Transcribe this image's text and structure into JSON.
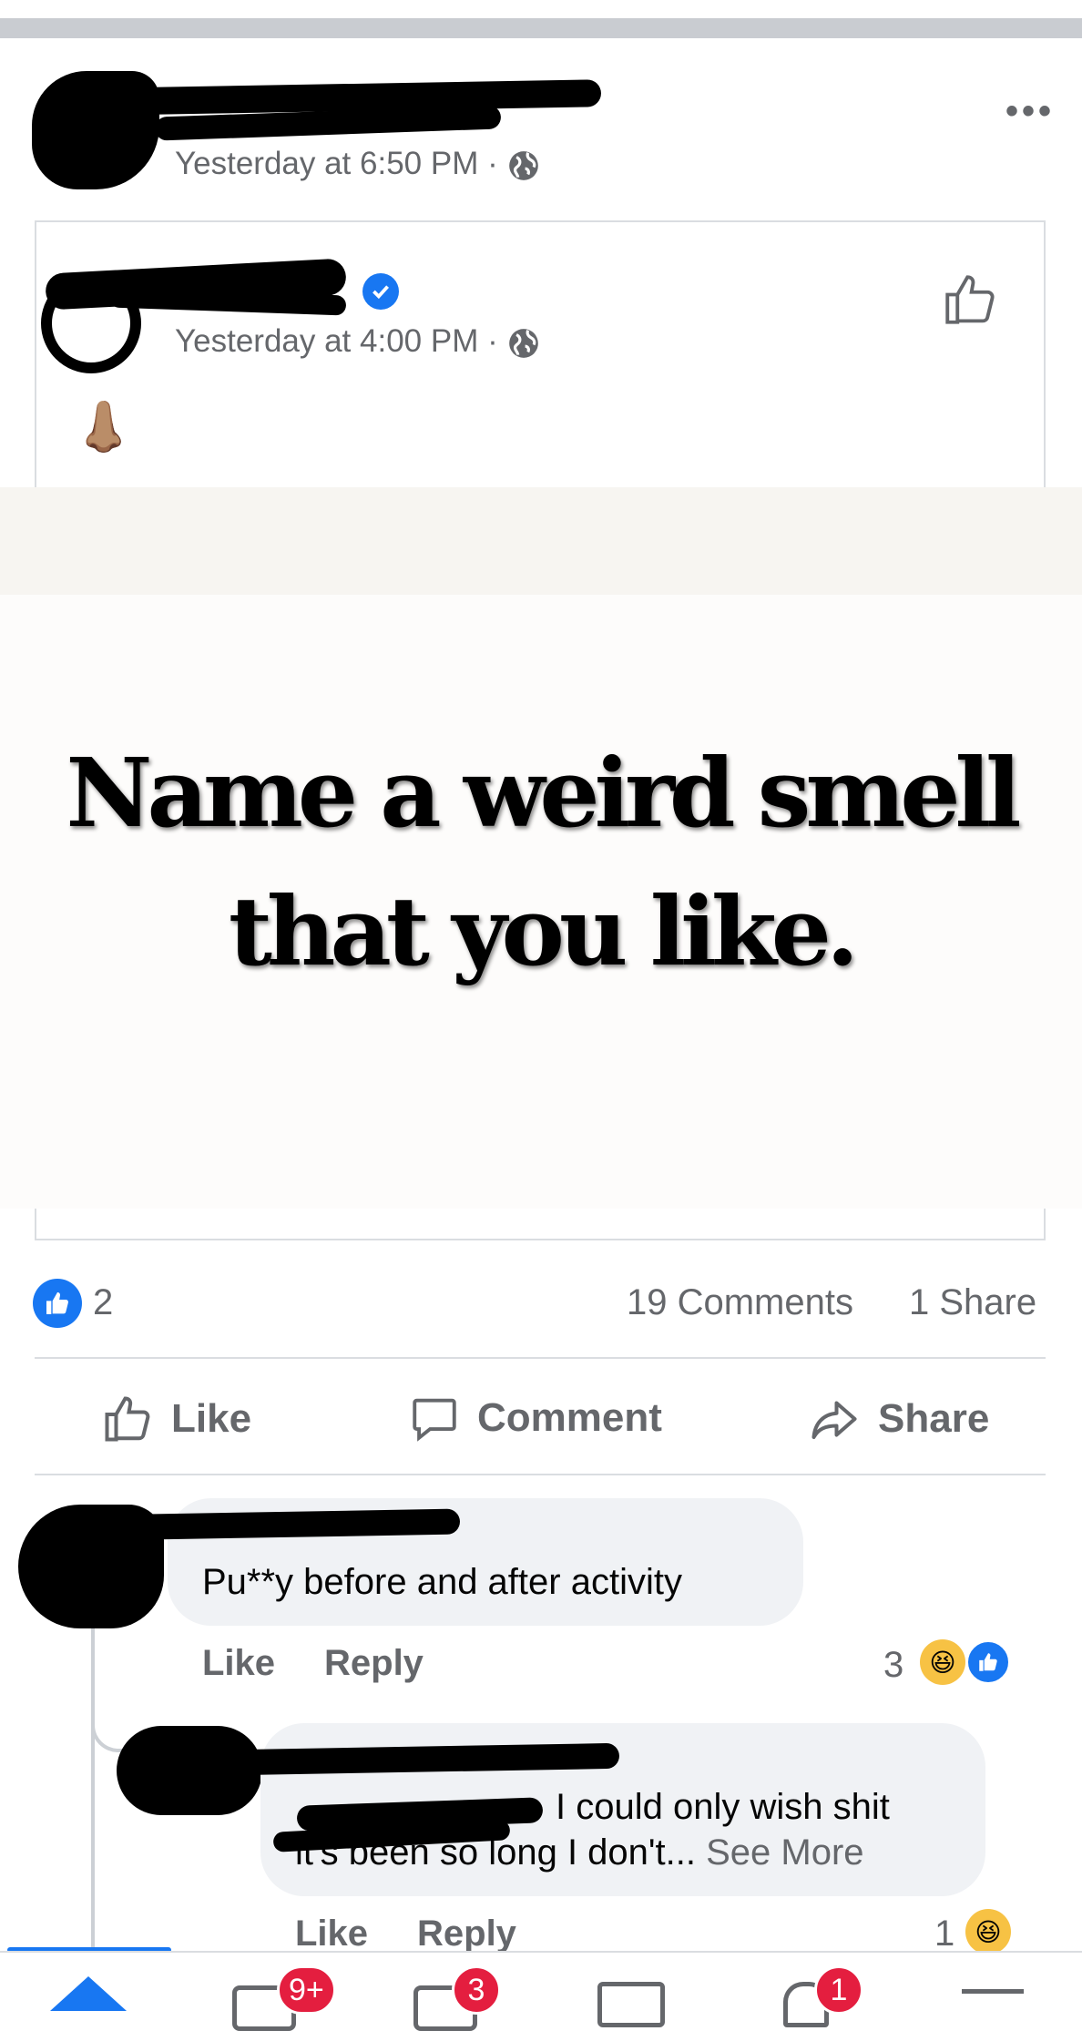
{
  "post": {
    "timestamp": "Yesterday at 6:50 PM",
    "separator": "·"
  },
  "shared_post": {
    "timestamp": "Yesterday at 4:00 PM",
    "separator": "·",
    "emoji": "👃🏽",
    "image_text": "Name a weird smell that you like."
  },
  "stats": {
    "reactions_count": "2",
    "comments": "19 Comments",
    "shares": "1 Share"
  },
  "actions": {
    "like": "Like",
    "comment": "Comment",
    "share": "Share"
  },
  "comments": [
    {
      "text": "Pu**y before and after activity",
      "like": "Like",
      "reply": "Reply",
      "reaction_count": "3"
    },
    {
      "text_tail": "I could only wish shit",
      "text_line2": "it's been so long I don't...",
      "see_more": "See More",
      "like": "Like",
      "reply": "Reply",
      "reaction_count": "1"
    }
  ],
  "nav": {
    "badges": [
      "9+",
      "3",
      "1"
    ]
  },
  "colors": {
    "accent": "#1877f2",
    "badge": "#e41e3f",
    "secondary_text": "#65676b",
    "bubble": "#f0f2f5"
  }
}
